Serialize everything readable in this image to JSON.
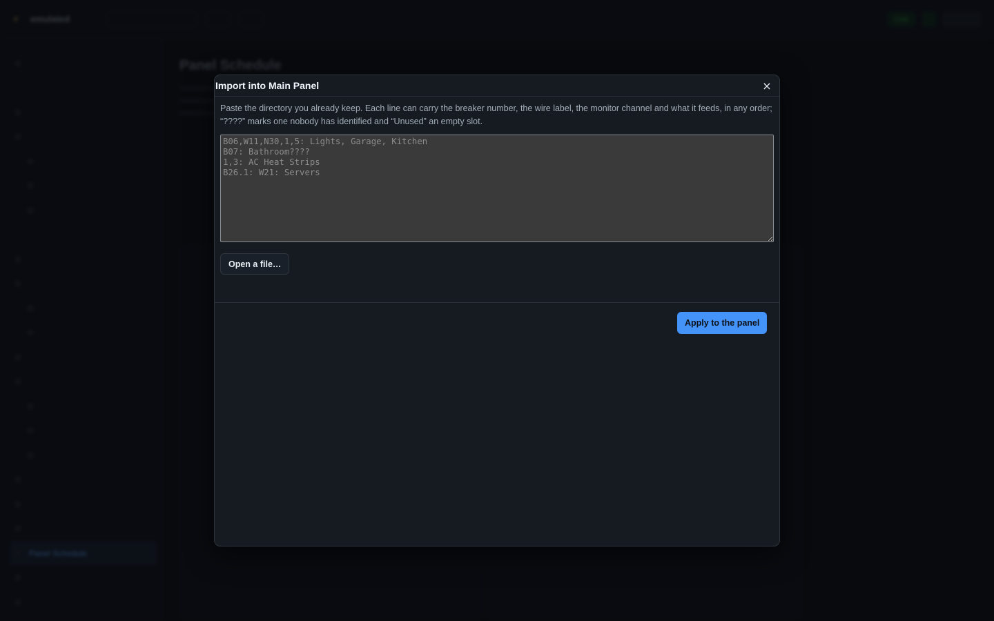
{
  "background": {
    "app_name": "emulated",
    "page_title": "Panel Schedule",
    "active_sidebar": "Panel Schedule",
    "status_pill": "Live"
  },
  "modal": {
    "title": "Import into Main Panel",
    "close_icon": "×",
    "description": "Paste the directory you already keep. Each line can carry the breaker number, the wire label, the monitor channel and what it feeds, in any order; “????” marks one nobody has identified and “Unused” an empty slot.",
    "textarea": {
      "value": "",
      "placeholder": "B06,W11,N30,1,5: Lights, Garage, Kitchen\nB07: Bathroom????\n1,3: AC Heat Strips\nB26.1: W21: Servers"
    },
    "open_file_label": "Open a file…",
    "apply_label": "Apply to the panel"
  },
  "colors": {
    "accent": "#4493f8",
    "modal_bg": "#161b22",
    "page_bg": "#0a0d12"
  }
}
